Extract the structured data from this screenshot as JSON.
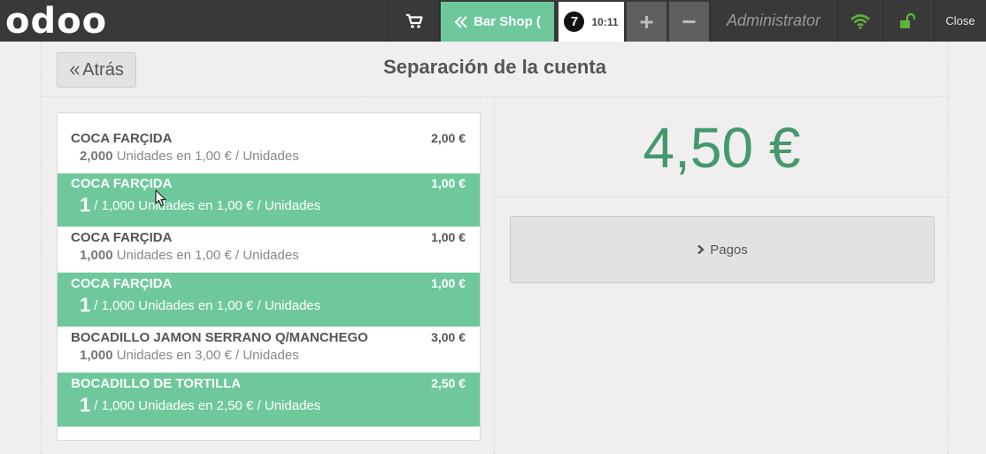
{
  "navbar": {
    "logo": "odoo",
    "shop_label": "Bar Shop (",
    "order_number": "7",
    "order_time": "10:11",
    "add_label": "+",
    "remove_label": "−",
    "user": "Administrator",
    "close_label": "Close",
    "icons": [
      "cart-icon",
      "double-chevron-left-icon",
      "wifi-icon",
      "unlock-icon"
    ],
    "colors": {
      "bar": "#393939",
      "accent": "#6ec89b",
      "status": "#5fb33a"
    }
  },
  "screen": {
    "back_label": "Atrás",
    "title": "Separación de la cuenta",
    "total": "4,50 €",
    "pay_label": "Pagos",
    "lines": [
      {
        "name": "COCA FARÇIDA",
        "price": "2,00 €",
        "selected": false,
        "qty": "2,000",
        "detail": "Unidades en 1,00 € / Unidades"
      },
      {
        "name": "COCA FARÇIDA",
        "price": "1,00 €",
        "selected": true,
        "qty": "1",
        "detail": "/ 1,000 Unidades en 1,00 € / Unidades"
      },
      {
        "name": "COCA FARÇIDA",
        "price": "1,00 €",
        "selected": false,
        "qty": "1,000",
        "detail": "Unidades en 1,00 € / Unidades"
      },
      {
        "name": "COCA FARÇIDA",
        "price": "1,00 €",
        "selected": true,
        "qty": "1",
        "detail": "/ 1,000 Unidades en 1,00 € / Unidades"
      },
      {
        "name": "BOCADILLO JAMON SERRANO Q/MANCHEGO",
        "price": "3,00 €",
        "selected": false,
        "qty": "1,000",
        "detail": "Unidades en 3,00 € / Unidades"
      },
      {
        "name": "BOCADILLO DE TORTILLA",
        "price": "2,50 €",
        "selected": true,
        "qty": "1",
        "detail": "/ 1,000 Unidades en 2,50 € / Unidades"
      }
    ],
    "colors": {
      "selected_line": "#6ec89b",
      "total_text": "#43996b"
    }
  }
}
